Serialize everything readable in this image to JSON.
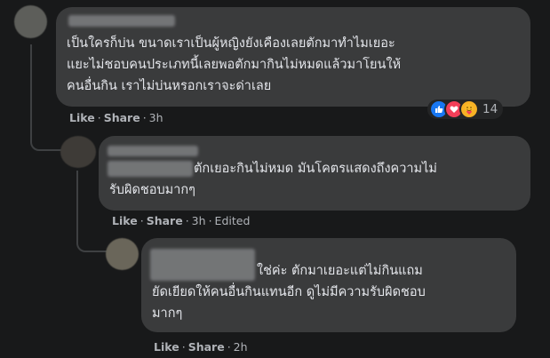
{
  "comments": [
    {
      "id": "c1",
      "text_lines": [
        "เป็นใครก็บ่น ขนาดเราเป็นผู้หญิงยังเคืองเลยตักมาทำไมเยอะ",
        "แยะไม่ชอบคนประเภทนี้เลยพอตักมากินไม่หมดแล้วมาโยนให้",
        "คนอื่นกิน เราไม่บ่นหรอกเราจะด่าเลย"
      ],
      "like_label": "Like",
      "share_label": "Share",
      "time": "3h",
      "reaction_count": "14",
      "reaction_icons": [
        "thumbs-up-icon",
        "heart-icon",
        "care-icon"
      ]
    },
    {
      "id": "c2",
      "text_lines": [
        "ตักเยอะกินไม่หมด มันโคตรแสดงถึงความไม่",
        "รับผิดชอบมากๆ"
      ],
      "like_label": "Like",
      "share_label": "Share",
      "time": "3h",
      "edited_label": "Edited"
    },
    {
      "id": "c3",
      "text_lines": [
        "ใช่ค่ะ ตักมาเยอะแต่ไม่กินแถม",
        "ยัดเยียดให้คนอื่นกินแทนอีก ดูไม่มีความรับผิดชอบ",
        "มากๆ"
      ],
      "like_label": "Like",
      "share_label": "Share",
      "time": "2h"
    }
  ],
  "colors": {
    "background": "#18191a",
    "bubble": "#3a3b3c",
    "text": "#e4e6eb",
    "secondary_text": "#b0b3b8",
    "like_blue": "#1877f2",
    "love_red": "#f33e58"
  }
}
